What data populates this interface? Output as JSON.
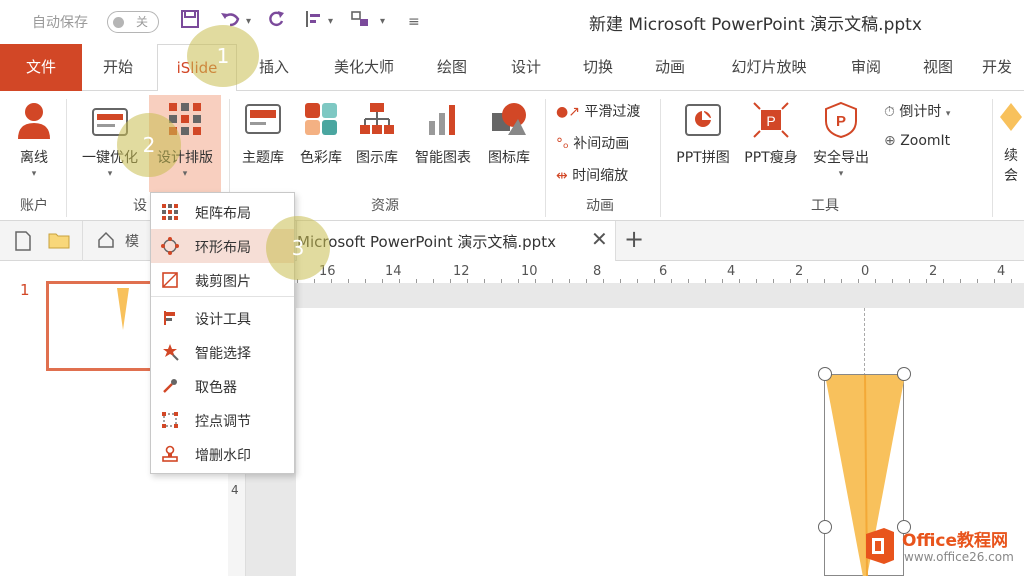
{
  "titlebar": {
    "autosave": "自动保存",
    "toggle": "关",
    "doc_title": "新建 Microsoft PowerPoint 演示文稿.pptx"
  },
  "tabs": [
    {
      "label": "文件"
    },
    {
      "label": "开始"
    },
    {
      "label": "iSlide"
    },
    {
      "label": "插入"
    },
    {
      "label": "美化大师"
    },
    {
      "label": "绘图"
    },
    {
      "label": "设计"
    },
    {
      "label": "切换"
    },
    {
      "label": "动画"
    },
    {
      "label": "幻灯片放映"
    },
    {
      "label": "审阅"
    },
    {
      "label": "视图"
    },
    {
      "label": "开发"
    }
  ],
  "ribbon": {
    "account": {
      "btn": "离线",
      "group": "账户"
    },
    "design": {
      "btn1": "一键优化",
      "btn2": "设计排版",
      "group": "设"
    },
    "resources": {
      "items": [
        "主题库",
        "色彩库",
        "图示库",
        "智能图表",
        "图标库"
      ],
      "group": "资源"
    },
    "animation": {
      "items": [
        "平滑过渡",
        "补间动画",
        "时间缩放"
      ],
      "group": "动画"
    },
    "tools": {
      "items": [
        "PPT拼图",
        "PPT瘦身",
        "安全导出"
      ],
      "countdown": "倒计时",
      "zoomit": "ZoomIt",
      "group": "工具"
    },
    "extra": {
      "line1": "续",
      "line2": "会"
    }
  },
  "doctabs": {
    "partial": "模",
    "doc": "Microsoft PowerPoint 演示文稿.pptx"
  },
  "ruler": {
    "ticks": [
      "16",
      "14",
      "12",
      "10",
      "8",
      "6",
      "4",
      "2",
      "0",
      "2",
      "4"
    ],
    "v_tick": "4"
  },
  "slide_number": "1",
  "dropdown": {
    "items": [
      "矩阵布局",
      "环形布局",
      "裁剪图片",
      "设计工具",
      "智能选择",
      "取色器",
      "控点调节",
      "增删水印"
    ]
  },
  "steps": [
    "1",
    "2",
    "3"
  ],
  "watermark": {
    "brand": "Office教程网",
    "url": "www.office26.com"
  },
  "colors": {
    "accent": "#d24726",
    "purple": "#7b4a9b",
    "shape": "#f8c15c"
  }
}
